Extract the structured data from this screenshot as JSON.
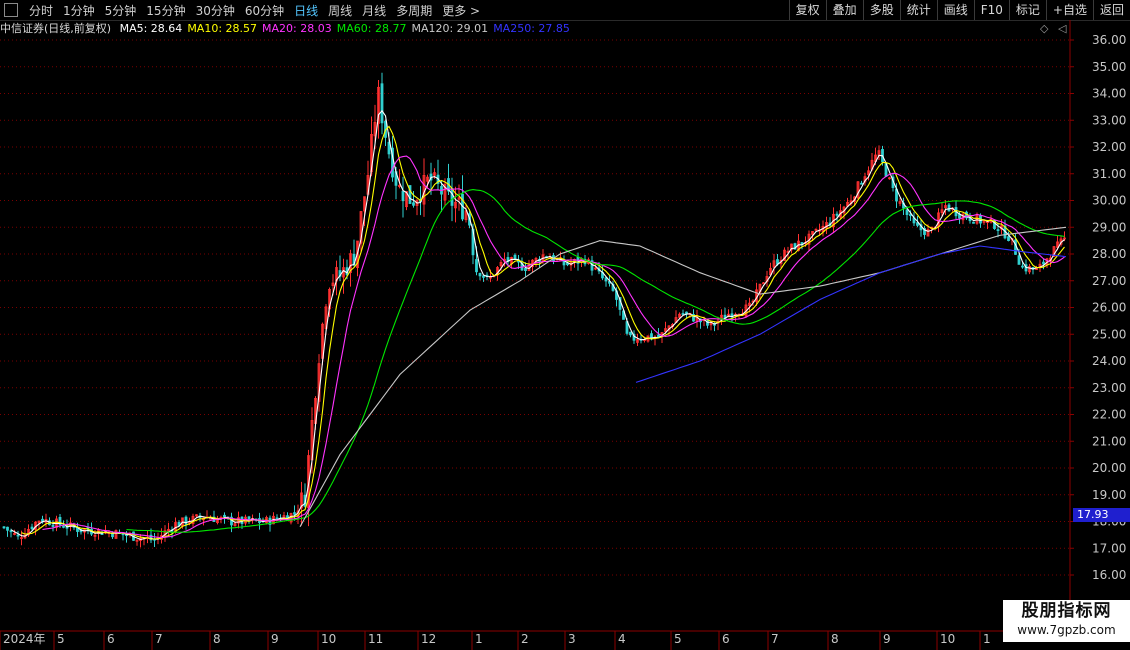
{
  "toolbar": {
    "periods": [
      "分时",
      "1分钟",
      "5分钟",
      "15分钟",
      "30分钟",
      "60分钟",
      "日线",
      "周线",
      "月线",
      "多周期",
      "更多 >"
    ],
    "active_period": "日线",
    "right_buttons": [
      "复权",
      "叠加",
      "多股",
      "统计",
      "画线",
      "F10",
      "标记",
      "+自选",
      "返回"
    ]
  },
  "legend": {
    "title": "中信证券(日线,前复权)",
    "ma": [
      {
        "label": "MA5: 28.64",
        "color": "#ffffff"
      },
      {
        "label": "MA10: 28.57",
        "color": "#ffff00"
      },
      {
        "label": "MA20: 28.03",
        "color": "#ff33ff"
      },
      {
        "label": "MA60: 28.77",
        "color": "#00e600"
      },
      {
        "label": "MA120: 29.01",
        "color": "#c8c8c8"
      },
      {
        "label": "MA250: 27.85",
        "color": "#3333ff"
      }
    ]
  },
  "current_price": "17.93",
  "watermark": {
    "title": "股朋指标网",
    "url": "www.7gpzb.com"
  },
  "chart_data": {
    "type": "candlestick",
    "title": "中信证券(日线,前复权)",
    "y_ticks": [
      36.0,
      35.0,
      34.0,
      33.0,
      32.0,
      31.0,
      30.0,
      29.0,
      28.0,
      27.0,
      26.0,
      25.0,
      24.0,
      23.0,
      22.0,
      21.0,
      20.0,
      19.0,
      18.0,
      17.0,
      16.0
    ],
    "x_labels": [
      "2024年",
      "5",
      "6",
      "7",
      "8",
      "9",
      "10",
      "11",
      "12",
      "1",
      "2",
      "3",
      "4",
      "5",
      "6",
      "7",
      "8",
      "9",
      "10",
      "1"
    ],
    "price_anchors": [
      [
        0,
        17.9
      ],
      [
        18,
        17.4
      ],
      [
        40,
        18.1
      ],
      [
        80,
        17.7
      ],
      [
        110,
        17.6
      ],
      [
        155,
        17.3
      ],
      [
        175,
        17.9
      ],
      [
        205,
        18.2
      ],
      [
        230,
        18.0
      ],
      [
        265,
        18.0
      ],
      [
        295,
        18.3
      ],
      [
        305,
        19.0
      ],
      [
        318,
        24.0
      ],
      [
        328,
        27.0
      ],
      [
        340,
        27.2
      ],
      [
        355,
        28.0
      ],
      [
        368,
        31.0
      ],
      [
        378,
        34.0
      ],
      [
        388,
        32.0
      ],
      [
        398,
        30.5
      ],
      [
        412,
        30.0
      ],
      [
        430,
        30.8
      ],
      [
        450,
        30.0
      ],
      [
        468,
        29.6
      ],
      [
        476,
        27.5
      ],
      [
        488,
        27.0
      ],
      [
        505,
        27.8
      ],
      [
        525,
        27.5
      ],
      [
        545,
        28.0
      ],
      [
        565,
        27.6
      ],
      [
        585,
        27.8
      ],
      [
        600,
        27.2
      ],
      [
        615,
        26.5
      ],
      [
        628,
        24.8
      ],
      [
        640,
        24.9
      ],
      [
        660,
        24.9
      ],
      [
        680,
        25.8
      ],
      [
        695,
        25.6
      ],
      [
        710,
        25.3
      ],
      [
        730,
        25.8
      ],
      [
        750,
        26.0
      ],
      [
        770,
        27.5
      ],
      [
        790,
        28.2
      ],
      [
        810,
        28.6
      ],
      [
        830,
        29.2
      ],
      [
        850,
        30.0
      ],
      [
        865,
        31.0
      ],
      [
        878,
        31.8
      ],
      [
        895,
        30.2
      ],
      [
        915,
        29.0
      ],
      [
        930,
        28.8
      ],
      [
        945,
        29.8
      ],
      [
        960,
        29.5
      ],
      [
        975,
        29.3
      ],
      [
        995,
        29.1
      ],
      [
        1010,
        28.6
      ],
      [
        1022,
        27.5
      ],
      [
        1038,
        27.4
      ],
      [
        1050,
        28.0
      ],
      [
        1066,
        28.6
      ]
    ],
    "series": [
      {
        "name": "MA5",
        "value": 28.64,
        "color": "#ffffff"
      },
      {
        "name": "MA10",
        "value": 28.57,
        "color": "#ffff00"
      },
      {
        "name": "MA20",
        "value": 28.03,
        "color": "#ff33ff"
      },
      {
        "name": "MA60",
        "value": 28.77,
        "color": "#00e600"
      },
      {
        "name": "MA120",
        "value": 29.01,
        "color": "#c8c8c8"
      },
      {
        "name": "MA250",
        "value": 27.85,
        "color": "#3333ff"
      }
    ],
    "ma120_points": [
      [
        300,
        17.8
      ],
      [
        340,
        20.5
      ],
      [
        400,
        23.5
      ],
      [
        470,
        25.9
      ],
      [
        520,
        27.0
      ],
      [
        560,
        28.0
      ],
      [
        600,
        28.5
      ],
      [
        640,
        28.3
      ],
      [
        700,
        27.3
      ],
      [
        760,
        26.5
      ],
      [
        820,
        26.8
      ],
      [
        880,
        27.3
      ],
      [
        940,
        28.0
      ],
      [
        1000,
        28.7
      ],
      [
        1066,
        29.0
      ]
    ],
    "ma250_points": [
      [
        636,
        23.2
      ],
      [
        700,
        24.0
      ],
      [
        760,
        25.0
      ],
      [
        820,
        26.3
      ],
      [
        880,
        27.3
      ],
      [
        940,
        28.0
      ],
      [
        980,
        28.3
      ],
      [
        1020,
        28.1
      ],
      [
        1066,
        27.9
      ]
    ]
  }
}
